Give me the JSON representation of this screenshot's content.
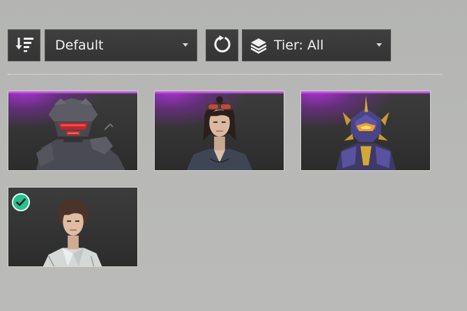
{
  "toolbar": {
    "sort_icon": "sort-descending-icon",
    "sort_select": {
      "value": "Default"
    },
    "reset_icon": "refresh-icon",
    "tier_filter": {
      "icon": "layers-icon",
      "value": "Tier: All"
    }
  },
  "grid": {
    "items": [
      {
        "name": "robot-helmet-outfit",
        "rarity_color": "#c04fe0",
        "selected": false
      },
      {
        "name": "goggles-girl-outfit",
        "rarity_color": "#c04fe0",
        "selected": false
      },
      {
        "name": "purple-armor-outfit",
        "rarity_color": "#c04fe0",
        "selected": false
      },
      {
        "name": "white-jacket-outfit",
        "rarity_color": null,
        "selected": true
      }
    ]
  },
  "colors": {
    "epic": "#c04fe0",
    "selected_check": "#27c08f",
    "toolbar_bg": "#3a3a3a"
  }
}
